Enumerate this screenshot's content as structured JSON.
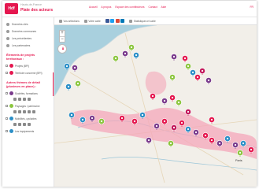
{
  "header": {
    "logo_text": "Hdf",
    "brand": "Hauts-de-France",
    "site_title": "Plate des acteurs",
    "nav": [
      "Accueil",
      "A propos",
      "Espace des contributeurs",
      "Contact",
      "Aide"
    ],
    "lang": "FR"
  },
  "sidebar": {
    "menu": [
      {
        "label": "Données clés"
      },
      {
        "label": "Données communes"
      },
      {
        "label": "Les précédentes"
      },
      {
        "label": "Les partenaires"
      }
    ],
    "section1_title": "Éléments de projets territoriaux :",
    "layers1": [
      {
        "label": "Projets (BPI)",
        "color": "#e5174f"
      },
      {
        "label": "Territoire concerné (BPI)",
        "color": "#e5174f"
      }
    ],
    "section2_title": "Autres thèmes de détail (plusieurs en place) :",
    "layers2": [
      {
        "label": "Sociétés, formations",
        "color": "#7a3a8c"
      },
      {
        "label": "Paysages / patrimoine",
        "color": "#8cc63f"
      },
      {
        "label": "Mobilités, cyclables",
        "color": "#2b8fc7"
      },
      {
        "label": "Les équipements",
        "color": "#2b8fc7"
      }
    ]
  },
  "toolbar": {
    "items": [
      "Vos sélections",
      "Votre carte",
      "Statistiques et carte"
    ],
    "social_colors": [
      "#3b5998",
      "#1da1f2",
      "#dd4b39",
      "#0077b5"
    ]
  },
  "map": {
    "city_label": "Paris",
    "colors": {
      "water": "#a9d0de",
      "land": "#f2efe9",
      "zone": "#f4a7b9",
      "accent": "#e5174f",
      "purple": "#7a3a8c",
      "green": "#8cc63f",
      "blue": "#2b8fc7",
      "magenta": "#c2185b"
    },
    "zoom_in": "+",
    "zoom_out": "−"
  }
}
